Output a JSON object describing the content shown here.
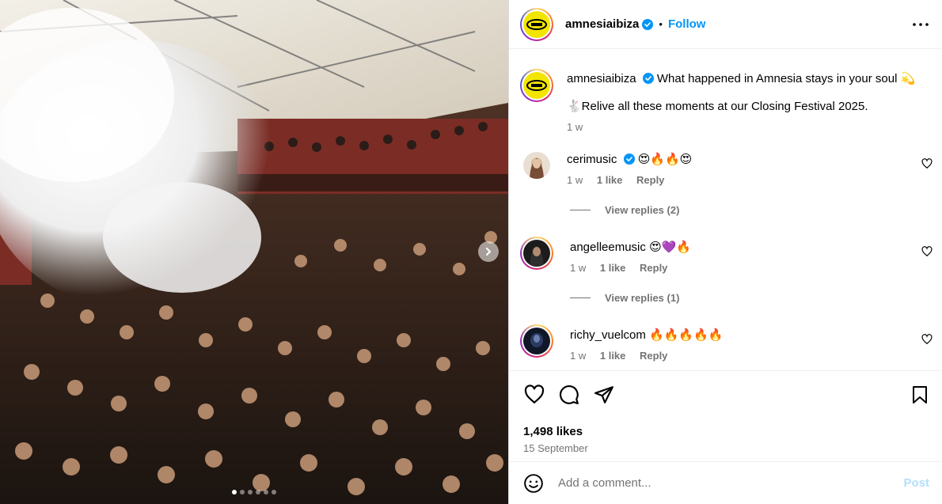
{
  "post": {
    "username": "amnesiaibiza",
    "follow_label": "Follow",
    "separator": "•",
    "caption_line1": "What happened in Amnesia stays in your soul 💫",
    "caption_line2": "🐇Relive all these moments at our Closing Festival 2025.",
    "caption_time": "1 w",
    "likes": "1,498 likes",
    "date": "15 September",
    "add_comment_placeholder": "Add a comment...",
    "post_label": "Post"
  },
  "comments": [
    {
      "username": "cerimusic",
      "verified": true,
      "text": "😍🔥🔥😍",
      "time": "1 w",
      "likes": "1 like",
      "reply": "Reply",
      "view_replies": "View replies (2)"
    },
    {
      "username": "angelleemusic",
      "verified": false,
      "text": "😍💜🔥",
      "time": "1 w",
      "likes": "1 like",
      "reply": "Reply",
      "view_replies": "View replies (1)"
    },
    {
      "username": "richy_vuelcom",
      "verified": false,
      "text": "🔥🔥🔥🔥🔥",
      "time": "1 w",
      "likes": "1 like",
      "reply": "Reply"
    }
  ],
  "carousel": {
    "total_slides": 6,
    "active_slide": 1
  },
  "icons": {
    "like": "heart-icon",
    "comment": "comment-bubble-icon",
    "share": "paper-plane-icon",
    "save": "bookmark-icon",
    "more": "more-options-icon",
    "emoji": "emoji-icon",
    "verified": "verified-badge-icon",
    "next": "chevron-right-icon"
  },
  "colors": {
    "accent": "#0095f6",
    "muted": "#737373",
    "post_disabled": "#b2dffc",
    "brand_yellow": "#f2e600"
  }
}
